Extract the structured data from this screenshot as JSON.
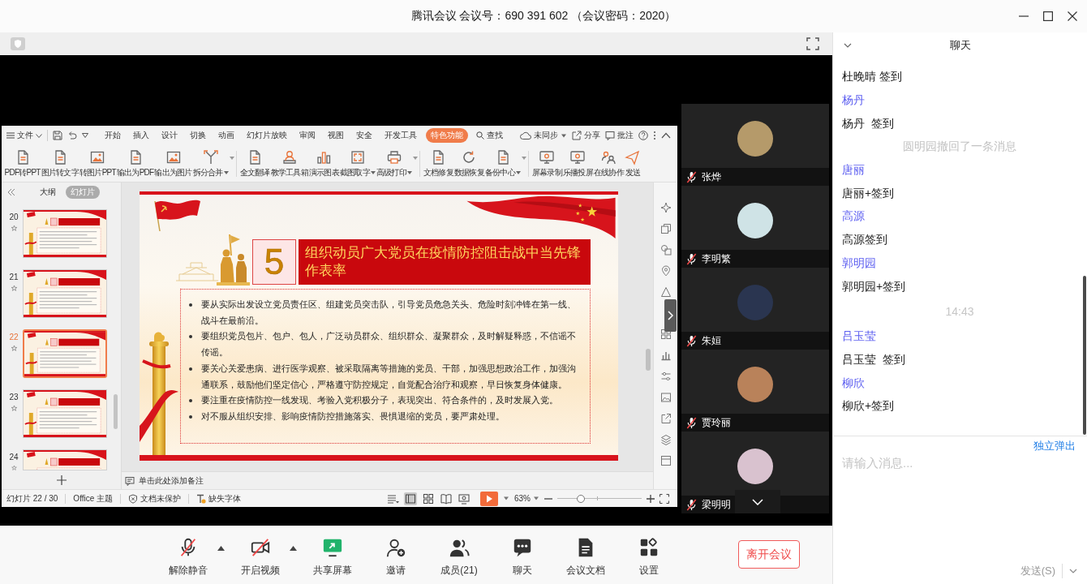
{
  "window": {
    "title": "腾讯会议 会议号：690 391 602 （会议密码：2020）"
  },
  "shared_screen": {
    "menu": {
      "file": "文件",
      "tabs": [
        {
          "label": "开始",
          "selected": false
        },
        {
          "label": "插入",
          "selected": false
        },
        {
          "label": "设计",
          "selected": false
        },
        {
          "label": "切换",
          "selected": false
        },
        {
          "label": "动画",
          "selected": false
        },
        {
          "label": "幻灯片放映",
          "selected": false
        },
        {
          "label": "审阅",
          "selected": false
        },
        {
          "label": "视图",
          "selected": false
        },
        {
          "label": "安全",
          "selected": false
        },
        {
          "label": "开发工具",
          "selected": false
        },
        {
          "label": "特色功能",
          "selected": true
        }
      ],
      "search": "查找",
      "sync": "未同步",
      "share": "分享",
      "comments": "批注"
    },
    "ribbon": {
      "groups": [
        {
          "items": [
            {
              "label": "PDF转PPT",
              "dropdown": false
            },
            {
              "label": "图片转文字",
              "dropdown": false
            },
            {
              "label": "转图片PPT",
              "dropdown": false
            },
            {
              "label": "输出为PDF",
              "dropdown": false
            },
            {
              "label": "输出为图片",
              "dropdown": false
            },
            {
              "label": "拆分合并",
              "dropdown": true
            }
          ]
        },
        {
          "items": [
            {
              "label": "全文翻译",
              "dropdown": false
            },
            {
              "label": "教学工具箱",
              "dropdown": false
            },
            {
              "label": "演示图表",
              "dropdown": false
            },
            {
              "label": "截图取字",
              "dropdown": true
            },
            {
              "label": "高级打印",
              "dropdown": true
            }
          ]
        },
        {
          "items": [
            {
              "label": "文档修复",
              "dropdown": false
            },
            {
              "label": "数据恢复",
              "dropdown": false
            },
            {
              "label": "备份中心",
              "dropdown": true
            }
          ]
        },
        {
          "items": [
            {
              "label": "屏幕录制",
              "dropdown": false
            },
            {
              "label": "乐播投屏",
              "dropdown": false
            },
            {
              "label": "在线协作",
              "dropdown": false
            },
            {
              "label": "发送",
              "dropdown": false
            }
          ]
        }
      ]
    },
    "slide_panel": {
      "tabs": [
        {
          "label": "大纲",
          "selected": false
        },
        {
          "label": "幻灯片",
          "selected": true
        }
      ],
      "slides": [
        {
          "number": "20",
          "selected": false
        },
        {
          "number": "21",
          "selected": false
        },
        {
          "number": "22",
          "selected": true
        },
        {
          "number": "23",
          "selected": false
        },
        {
          "number": "24",
          "selected": false
        }
      ]
    },
    "slide": {
      "number": "5",
      "title": "组织动员广大党员在疫情防控阻击战中当先锋作表率",
      "bullets": [
        "要从实际出发设立党员责任区、组建党员突击队，引导党员危急关头、危险时刻冲锋在第一线、战斗在最前沿。",
        "要组织党员包片、包户、包人，广泛动员群众、组织群众、凝聚群众，及时解疑释惑，不信谣不传谣。",
        "要关心关爱患病、进行医学观察、被采取隔离等措施的党员、干部，加强思想政治工作，加强沟通联系，鼓励他们坚定信心，严格遵守防控规定，自觉配合治疗和观察，早日恢复身体健康。",
        "要注重在疫情防控一线发现、考验入党积极分子，表现突出、符合条件的，及时发展入党。",
        "对不服从组织安排、影响疫情防控措施落实、畏惧退缩的党员，要严肃处理。"
      ]
    },
    "notes": {
      "placeholder": "单击此处添加备注"
    },
    "status_bar": {
      "slide_counter": "幻灯片 22 / 30",
      "theme": "Office 主题",
      "protection": "文档未保护",
      "missing_fonts": "缺失字体",
      "views": [
        {
          "selected": true
        },
        {
          "selected": false
        },
        {
          "selected": false
        },
        {
          "selected": false
        }
      ],
      "zoom": "63%",
      "zoom_slider": {
        "level": 0.28
      }
    }
  },
  "participants": [
    {
      "name": "张烨",
      "muted": true
    },
    {
      "name": "李明繁",
      "muted": true
    },
    {
      "name": "朱姮",
      "muted": true
    },
    {
      "name": "贾玲丽",
      "muted": true
    },
    {
      "name": "梁明明",
      "muted": true
    }
  ],
  "toolbar": {
    "buttons": [
      {
        "label": "解除静音",
        "menu": true
      },
      {
        "label": "开启视频",
        "menu": true
      },
      {
        "label": "共享屏幕",
        "menu": false
      },
      {
        "label": "邀请",
        "menu": false
      },
      {
        "label": "成员(21)",
        "menu": false
      },
      {
        "label": "聊天",
        "menu": false
      },
      {
        "label": "会议文档",
        "menu": false
      },
      {
        "label": "设置",
        "menu": false
      }
    ],
    "leave": "离开会议"
  },
  "chat": {
    "title": "聊天",
    "messages": [
      {
        "kind": "text",
        "text": "杜晚晴 签到"
      },
      {
        "kind": "sender",
        "text": "杨丹"
      },
      {
        "kind": "text",
        "text": "杨丹  签到"
      },
      {
        "kind": "notice",
        "text": "圆明园撤回了一条消息"
      },
      {
        "kind": "sender",
        "text": "唐丽"
      },
      {
        "kind": "text",
        "text": "唐丽+签到"
      },
      {
        "kind": "sender",
        "text": "高源"
      },
      {
        "kind": "text",
        "text": "高源签到"
      },
      {
        "kind": "sender",
        "text": "郭明园"
      },
      {
        "kind": "text",
        "text": "郭明园+签到"
      },
      {
        "kind": "time",
        "text": "14:43"
      },
      {
        "kind": "sender",
        "text": "吕玉莹"
      },
      {
        "kind": "text",
        "text": "吕玉莹  签到"
      },
      {
        "kind": "sender",
        "text": "柳欣"
      },
      {
        "kind": "text",
        "text": "柳欣+签到"
      }
    ],
    "popout": "独立弹出",
    "input": {
      "placeholder": "请输入消息..."
    },
    "send": "发送(S)"
  }
}
